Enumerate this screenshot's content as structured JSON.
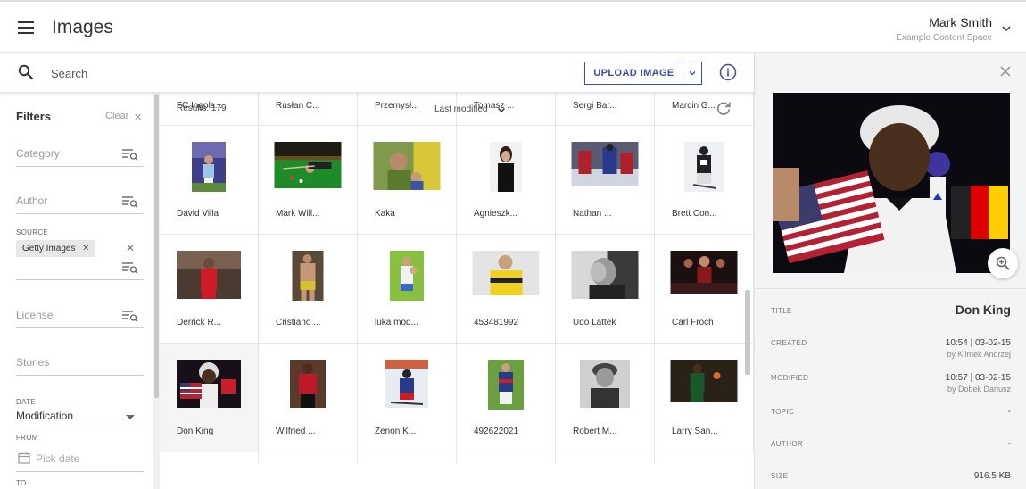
{
  "header": {
    "title": "Images",
    "user_name": "Mark Smith",
    "user_space": "Example Content Space"
  },
  "search": {
    "placeholder": "Search",
    "upload_label": "UPLOAD IMAGE"
  },
  "filters": {
    "title": "Filters",
    "clear_label": "Clear",
    "category_label": "Category",
    "author_label": "Author",
    "source_caption": "SOURCE",
    "source_chip": "Getty Images",
    "license_label": "License",
    "stories_label": "Stories",
    "date_caption": "DATE",
    "date_value": "Modification",
    "from_caption": "FROM",
    "pick_date": "Pick date",
    "to_caption": "TO"
  },
  "grid": {
    "results": "Results: 179",
    "sort": "Last modified",
    "top_row": [
      "FC Ingols...",
      "Rusłan C...",
      "Przemysł...",
      "Tomasz ...",
      "Sergi Bar...",
      "Marcin G..."
    ],
    "rows": [
      [
        "David Villa",
        "Mark Will...",
        "Kaka",
        "Agnieszk...",
        "Nathan ...",
        "Brett Con..."
      ],
      [
        "Derrick R...",
        "Cristiano ...",
        "luka mod...",
        "453481992",
        "Udo Lattek",
        "Carl Froch"
      ],
      [
        "Don King",
        "Wilfried ...",
        "Zenon K...",
        "492622021",
        "Robert M...",
        "Larry San..."
      ]
    ]
  },
  "details": {
    "title_label": "TITLE",
    "title_value": "Don King",
    "created_label": "CREATED",
    "created_value": "10:54 | 03-02-15",
    "created_by": "by Klimek Andrzej",
    "modified_label": "MODIFIED",
    "modified_value": "10:57 | 03-02-15",
    "modified_by": "by Dobek Dariusz",
    "topic_label": "TOPIC",
    "topic_value": "-",
    "author_label": "AUTHOR",
    "author_value": "-",
    "size_label": "SIZE",
    "size_value": "916.5 KB"
  },
  "colors": {
    "accent": "#3a4ea8",
    "panel_bg": "#f4f4f4"
  }
}
